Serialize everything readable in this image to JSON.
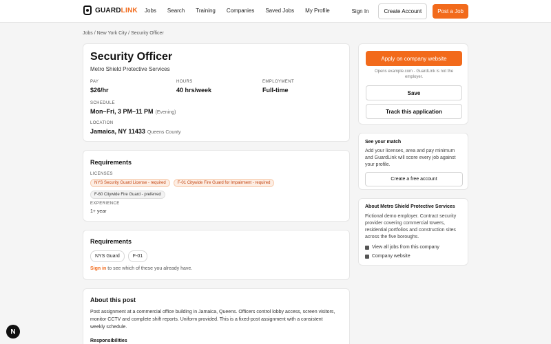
{
  "nav": {
    "brand_plain": "GUARD",
    "brand_accent": "LINK",
    "links": [
      "Jobs",
      "Search",
      "Training",
      "Companies",
      "Saved Jobs",
      "My Profile"
    ],
    "sign_in": "Sign In",
    "create_account": "Create Account",
    "post_job": "Post a Job"
  },
  "breadcrumb": {
    "part1": "Jobs",
    "sep": " / ",
    "part2": "New York City",
    "part3": "Security Officer"
  },
  "job": {
    "title": "Security Officer",
    "company": "Metro Shield Protective Services",
    "pay_label": "PAY",
    "pay": "$26/hr",
    "hours_label": "HOURS",
    "hours": "40 hrs/week",
    "employment_label": "EMPLOYMENT",
    "employment": "Full-time",
    "schedule_label": "SCHEDULE",
    "schedule": "Mon–Fri, 3 PM–11 PM",
    "schedule_sub": "(Evening)",
    "location_label": "LOCATION",
    "location": "Jamaica, NY 11433",
    "location_sub": "Queens County"
  },
  "requirements": {
    "title": "Requirements",
    "licenses_label": "LICENSES",
    "licenses": [
      {
        "text": "NYS Security Guard License - required",
        "kind": "required"
      },
      {
        "text": "F-01 Citywide Fire Guard for Impairment - required",
        "kind": "required"
      },
      {
        "text": "F-60 Citywide Fire Guard - preferred",
        "kind": "preferred"
      }
    ],
    "experience_label": "EXPERIENCE",
    "experience": "1+ year"
  },
  "requirements2": {
    "title": "Requirements",
    "chips": [
      "NYS Guard",
      "F-01"
    ],
    "sign_in_link": "Sign in",
    "sign_in_rest": " to see which of these you already have."
  },
  "about": {
    "title": "About this post",
    "text": "Post assignment at a commercial office building in Jamaica, Queens. Officers control lobby access, screen visitors, monitor CCTV and complete shift reports. Uniform provided. This is a fixed-post assignment with a consistent weekly schedule.",
    "responsibilities": "Responsibilities"
  },
  "apply": {
    "apply_label": "Apply on company website",
    "opens_note": "Opens example.com - GuardLink is not the employer.",
    "save_label": "Save",
    "track_label": "Track this application"
  },
  "match": {
    "title": "See your match",
    "text": "Add your licenses, area and pay minimum and GuardLink will score every job against your profile.",
    "cta": "Create a free account"
  },
  "company_card": {
    "title": "About Metro Shield Protective Services",
    "text": "Fictional demo employer. Contract security provider covering commercial towers, residential portfolios and construction sites across the five boroughs.",
    "view_all": "View all jobs from this company",
    "website": "Company website"
  },
  "badge": {
    "letter": "N"
  },
  "colors": {
    "accent": "#f26a1b",
    "required_chip_bg": "#fdeee4",
    "required_chip_text": "#c2410c"
  }
}
